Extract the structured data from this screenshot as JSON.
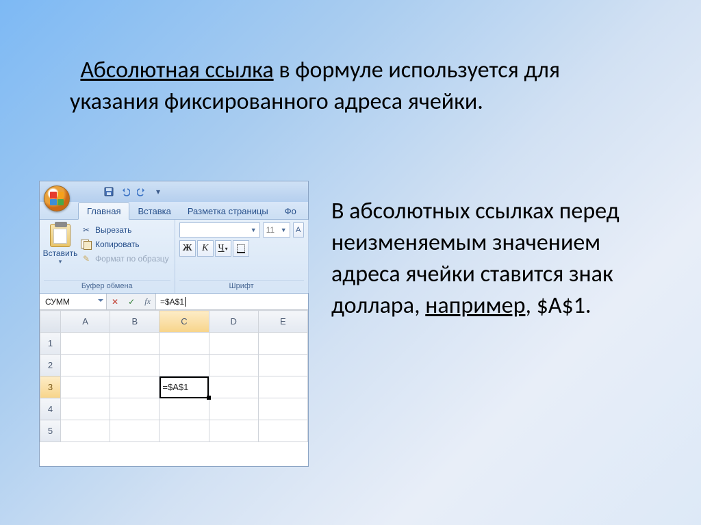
{
  "text": {
    "p1_u": "Абсолютная ссылка",
    "p1_rest": " в формуле используется для указания фиксированного адреса ячейки.",
    "p2_a": "В абсолютных ссылках перед неизменяемым значением адреса ячейки ставится знак доллара, ",
    "p2_u": "например",
    "p2_b": ", $A$1."
  },
  "excel": {
    "tabs": {
      "home": "Главная",
      "insert": "Вставка",
      "layout": "Разметка страницы",
      "fo": "Фо"
    },
    "clipboard": {
      "paste": "Вставить",
      "cut": "Вырезать",
      "copy": "Копировать",
      "format": "Формат по образцу",
      "title": "Буфер обмена"
    },
    "font": {
      "size": "11",
      "bold": "Ж",
      "italic": "К",
      "underline": "Ч",
      "title": "Шрифт"
    },
    "namebox": "СУММ",
    "fx": "fx",
    "formula": "=$A$1",
    "cols": [
      "A",
      "B",
      "C",
      "D",
      "E"
    ],
    "rows": [
      "1",
      "2",
      "3",
      "4",
      "5"
    ],
    "cell_c3": "=$A$1"
  }
}
